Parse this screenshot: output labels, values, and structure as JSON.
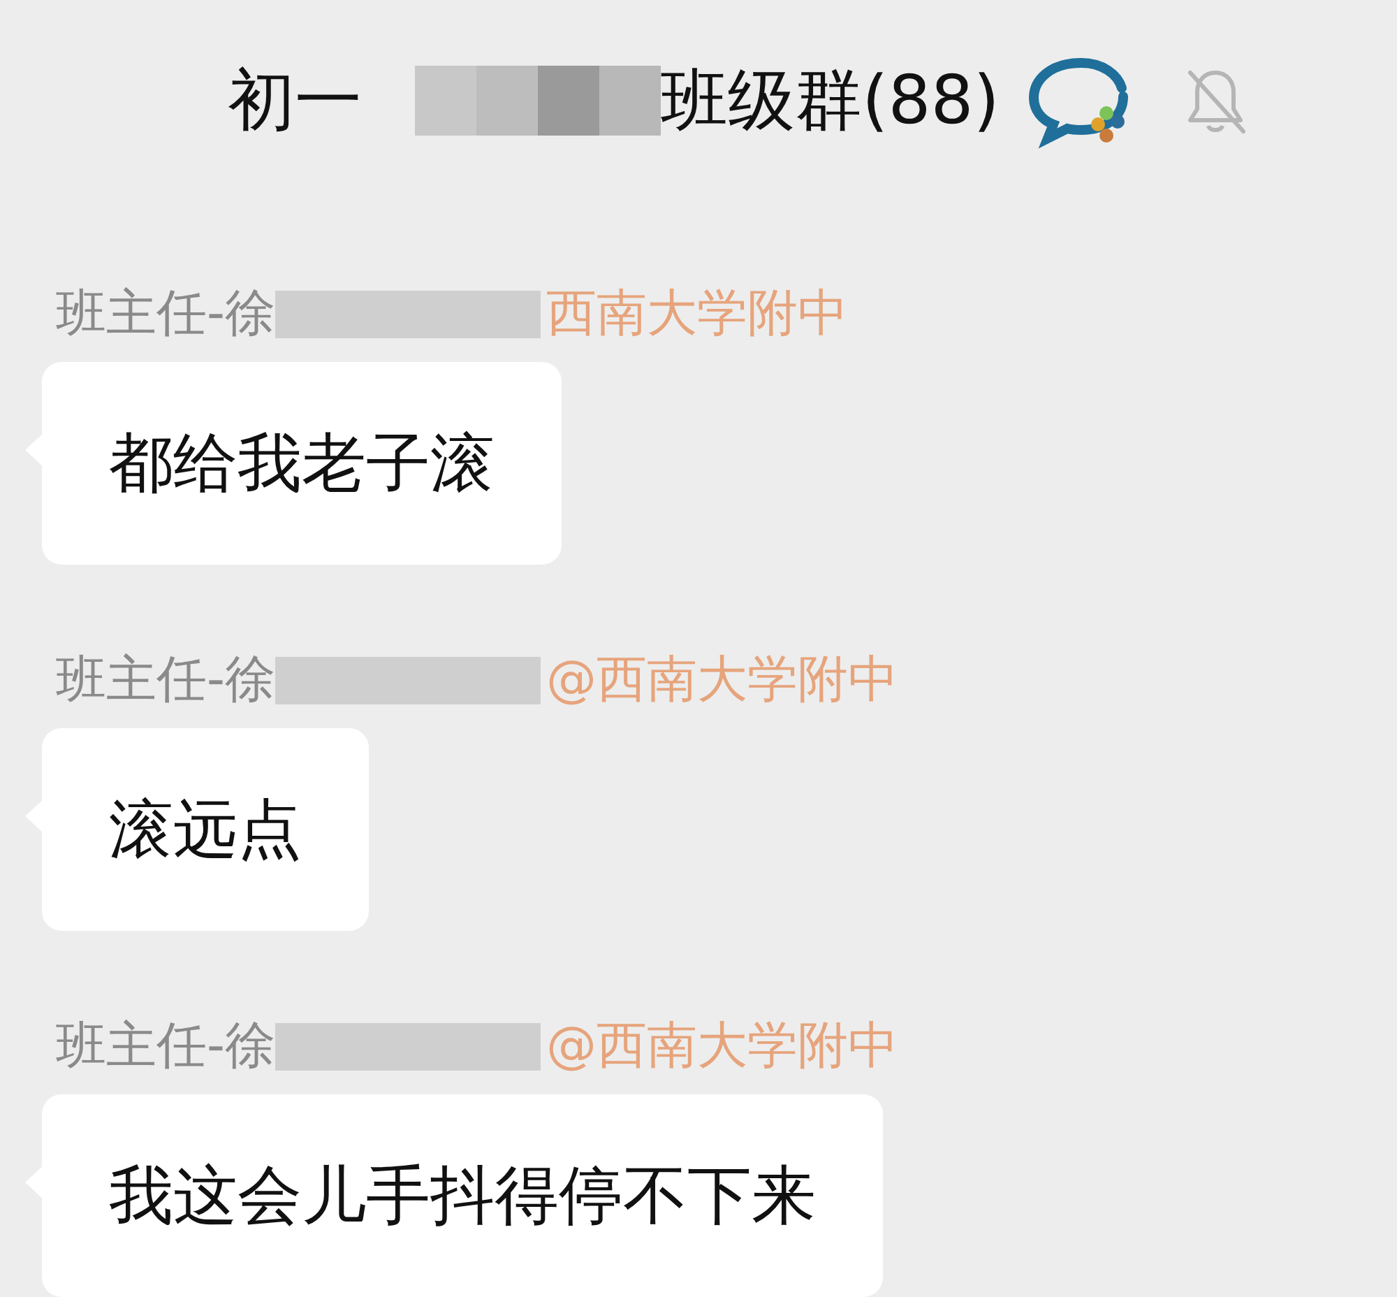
{
  "header": {
    "title_start": "初一",
    "title_end": "班级群(88)",
    "muted": true
  },
  "messages": [
    {
      "sender": "班主任-徐",
      "affiliation": "西南大学附中",
      "text": "都给我老子滚"
    },
    {
      "sender": "班主任-徐",
      "affiliation": "@西南大学附中",
      "text": "滚远点"
    },
    {
      "sender": "班主任-徐",
      "affiliation": "@西南大学附中",
      "text": "我这会儿手抖得停不下来"
    }
  ]
}
